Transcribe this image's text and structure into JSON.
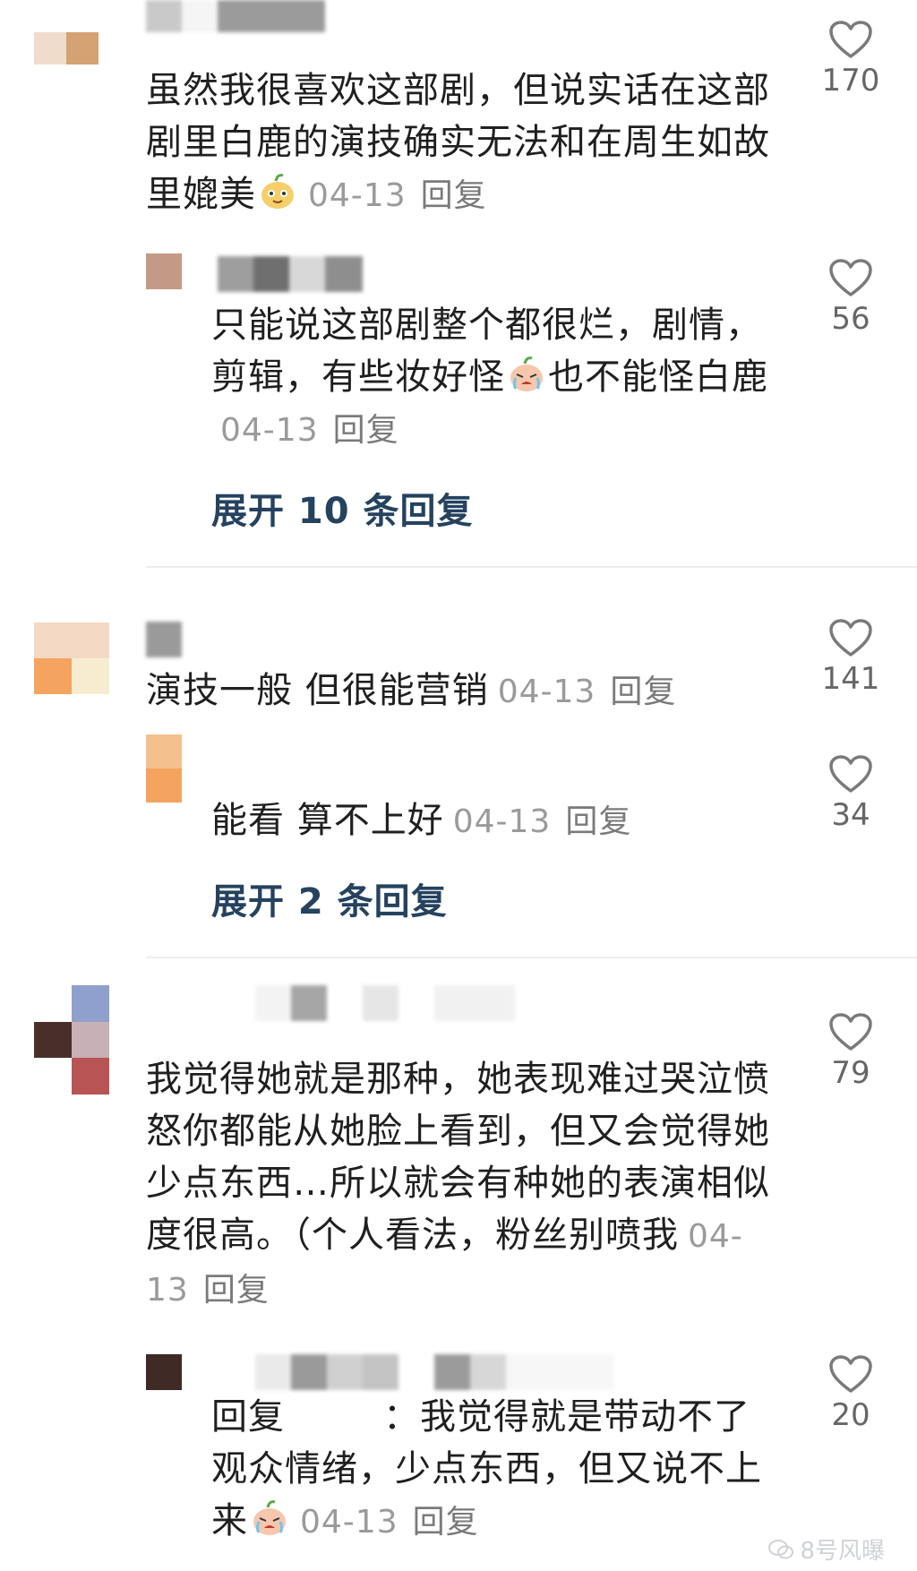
{
  "comments": [
    {
      "text": "虽然我很喜欢这部剧，但说实话在这部剧里白鹿的演技确实无法和在周生如故里媲美",
      "emoji": "smile-face-emoji",
      "date": "04-13",
      "reply_label": "回复",
      "likes": "170",
      "replies": [
        {
          "text_a": "只能说这部剧整个都很烂，剧情，剪辑，有些妆好怪",
          "text_b": "也不能怪白鹿",
          "emoji": "crying-face-emoji",
          "date": "04-13",
          "reply_label": "回复",
          "likes": "56"
        }
      ],
      "expand_label": "展开 10 条回复"
    },
    {
      "text": "演技一般 但很能营销",
      "date": "04-13",
      "reply_label": "回复",
      "likes": "141",
      "replies": [
        {
          "text": "能看 算不上好",
          "date": "04-13",
          "reply_label": "回复",
          "likes": "34"
        }
      ],
      "expand_label": "展开 2 条回复"
    },
    {
      "text": "我觉得她就是那种，她表现难过哭泣愤怒你都能从她脸上看到，但又会觉得她少点东西…所以就会有种她的表演相似度很高。（个人看法，粉丝别喷我",
      "date": "04-13",
      "reply_label": "回复",
      "likes": "79",
      "replies": [
        {
          "prefix": "回复",
          "text": "：我觉得就是带动不了观众情绪，少点东西，但又说不上来",
          "emoji": "crying-face-emoji",
          "date": "04-13",
          "reply_label": "回复",
          "likes": "20"
        }
      ]
    }
  ],
  "watermark": "8号风曝",
  "colors": {
    "background": "#ffffff",
    "expand_link": "#25425f",
    "meta": "#9a9a9a",
    "text": "#1f1f1f"
  }
}
